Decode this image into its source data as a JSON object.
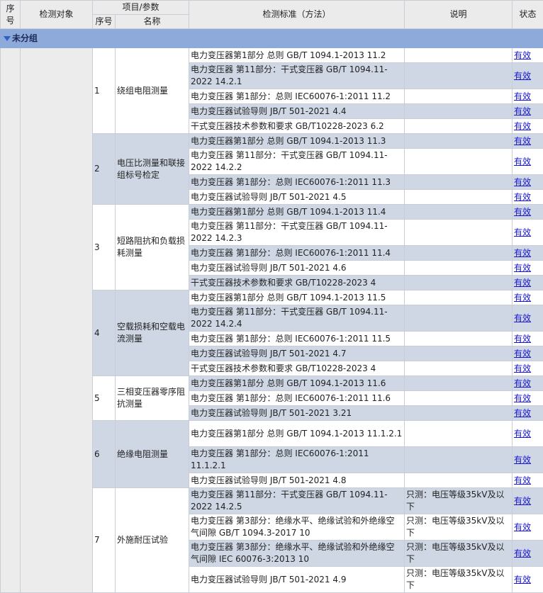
{
  "headers": {
    "seq": "序号",
    "object": "检测对象",
    "item_param": "项目/参数",
    "sub_seq": "序号",
    "sub_name": "名称",
    "standard": "检测标准（方法）",
    "note": "说明",
    "status": "状态"
  },
  "group": {
    "label": "未分组"
  },
  "items": [
    {
      "seq": "1",
      "name": "绕组电阻测量",
      "rows": [
        {
          "std": "电力变压器第1部分 总则 GB/T 1094.1-2013 11.2",
          "note": "",
          "status": "有效"
        },
        {
          "std": "电力变压器 第11部分：干式变压器 GB/T 1094.11-2022 14.2.1",
          "note": "",
          "status": "有效"
        },
        {
          "std": "电力变压器 第1部分：总则 IEC60076-1:2011 11.2",
          "note": "",
          "status": "有效"
        },
        {
          "std": "电力变压器试验导则 JB/T 501-2021 4.4",
          "note": "",
          "status": "有效"
        },
        {
          "std": "干式变压器技术参数和要求 GB/T10228-2023 6.2",
          "note": "",
          "status": "有效"
        }
      ]
    },
    {
      "seq": "2",
      "name": "电压比测量和联接组标号检定",
      "rows": [
        {
          "std": "电力变压器第1部分 总则 GB/T 1094.1-2013 11.3",
          "note": "",
          "status": "有效"
        },
        {
          "std": "电力变压器 第11部分：干式变压器 GB/T 1094.11-2022 14.2.2",
          "note": "",
          "status": "有效"
        },
        {
          "std": "电力变压器 第1部分：总则 IEC60076-1:2011 11.3",
          "note": "",
          "status": "有效"
        },
        {
          "std": "电力变压器试验导则 JB/T 501-2021 4.5",
          "note": "",
          "status": "有效"
        }
      ]
    },
    {
      "seq": "3",
      "name": "短路阻抗和负载损耗测量",
      "rows": [
        {
          "std": "电力变压器第1部分 总则 GB/T 1094.1-2013 11.4",
          "note": "",
          "status": "有效"
        },
        {
          "std": "电力变压器 第11部分：干式变压器 GB/T 1094.11-2022 14.2.3",
          "note": "",
          "status": "有效"
        },
        {
          "std": "电力变压器 第1部分：总则 IEC60076-1:2011 11.4",
          "note": "",
          "status": "有效"
        },
        {
          "std": "电力变压器试验导则 JB/T 501-2021 4.6",
          "note": "",
          "status": "有效"
        },
        {
          "std": "干式变压器技术参数和要求 GB/T10228-2023 4",
          "note": "",
          "status": "有效"
        }
      ]
    },
    {
      "seq": "4",
      "name": "空载损耗和空载电流测量",
      "rows": [
        {
          "std": "电力变压器第1部分 总则 GB/T 1094.1-2013 11.5",
          "note": "",
          "status": "有效"
        },
        {
          "std": "电力变压器 第11部分：干式变压器 GB/T 1094.11-2022 14.2.4",
          "note": "",
          "status": "有效"
        },
        {
          "std": "电力变压器 第1部分：总则 IEC60076-1:2011 11.5",
          "note": "",
          "status": "有效"
        },
        {
          "std": "电力变压器试验导则 JB/T 501-2021 4.7",
          "note": "",
          "status": "有效"
        },
        {
          "std": "干式变压器技术参数和要求 GB/T10228-2023 4",
          "note": "",
          "status": "有效"
        }
      ]
    },
    {
      "seq": "5",
      "name": "三相变压器零序阻抗测量",
      "rows": [
        {
          "std": "电力变压器第1部分 总则 GB/T 1094.1-2013 11.6",
          "note": "",
          "status": "有效"
        },
        {
          "std": "电力变压器 第1部分：总则 IEC60076-1:2011 11.6",
          "note": "",
          "status": "有效"
        },
        {
          "std": "电力变压器试验导则 JB/T 501-2021 3.21",
          "note": "",
          "status": "有效"
        }
      ]
    },
    {
      "seq": "6",
      "name": "绝缘电阻测量",
      "rows": [
        {
          "std": "电力变压器第1部分 总则 GB/T 1094.1-2013 11.1.2.1",
          "note": "",
          "status": "有效"
        },
        {
          "std": "电力变压器 第1部分：总则 IEC60076-1:2011 11.1.2.1",
          "note": "",
          "status": "有效"
        },
        {
          "std": "电力变压器试验导则 JB/T 501-2021 4.8",
          "note": "",
          "status": "有效"
        }
      ]
    },
    {
      "seq": "7",
      "name": "外施耐压试验",
      "rows": [
        {
          "std": "电力变压器 第11部分：干式变压器 GB/T 1094.11-2022 14.2.5",
          "note": "只测：电压等级35kV及以下",
          "status": "有效"
        },
        {
          "std": "电力变压器 第3部分：绝缘水平、绝缘试验和外绝缘空气间隙 GB/T 1094.3-2017 10",
          "note": "只测：电压等级35kV及以下",
          "status": "有效"
        },
        {
          "std": "电力变压器 第3部分：绝缘水平、绝缘试验和外绝缘空气间隙 IEC 60076-3:2013 10",
          "note": "只测：电压等级35kV及以下",
          "status": "有效"
        },
        {
          "std": "电力变压器试验导则 JB/T 501-2021 4.9",
          "note": "只测：电压等级35kV及以下",
          "status": "有效"
        }
      ]
    }
  ]
}
